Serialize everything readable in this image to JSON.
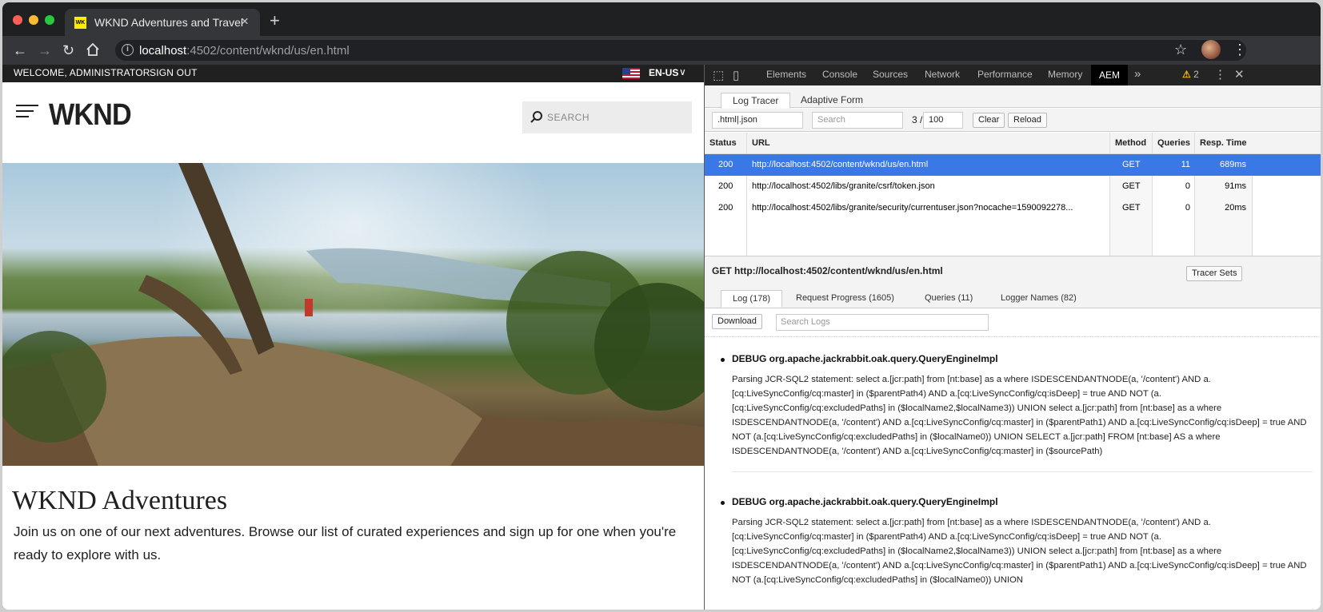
{
  "browser": {
    "tab_title": "WKND Adventures and Travel",
    "tab_favicon": "WK",
    "tab_close": "×",
    "new_tab": "+",
    "url_host": "localhost",
    "url_rest": ":4502/content/wknd/us/en.html",
    "icons": [
      "back-icon",
      "forward-icon",
      "reload-icon",
      "home-icon",
      "info-icon",
      "star-icon",
      "avatar",
      "menu-icon"
    ]
  },
  "site": {
    "welcome": "WELCOME, ADMINISTRATOR",
    "signout": "SIGN OUT",
    "lang": "EN-US",
    "logo": "WKND",
    "search_placeholder": "SEARCH",
    "hero_title": "WKND Adventures",
    "hero_text": "Join us on one of our next adventures. Browse our list of curated experiences and sign up for one when you're ready to explore with us."
  },
  "devtools": {
    "tabs": [
      "Elements",
      "Console",
      "Sources",
      "Network",
      "Performance",
      "Memory",
      "AEM"
    ],
    "more": "»",
    "warnings": "2",
    "panel_tabs": [
      "Log Tracer",
      "Adaptive Form"
    ],
    "filter_value": ".html|.json",
    "search_placeholder": "Search",
    "count_label": "3 /",
    "count_value": "100",
    "clear": "Clear",
    "reload": "Reload",
    "columns": [
      "Status",
      "URL",
      "Method",
      "Queries",
      "Resp. Time"
    ],
    "rows": [
      {
        "status": "200",
        "url": "http://localhost:4502/content/wknd/us/en.html",
        "method": "GET",
        "queries": "11",
        "time": "689ms"
      },
      {
        "status": "200",
        "url": "http://localhost:4502/libs/granite/csrf/token.json",
        "method": "GET",
        "queries": "0",
        "time": "91ms"
      },
      {
        "status": "200",
        "url": "http://localhost:4502/libs/granite/security/currentuser.json?nocache=1590092278...",
        "method": "GET",
        "queries": "0",
        "time": "20ms"
      }
    ],
    "detail_title": "GET http://localhost:4502/content/wknd/us/en.html",
    "tracer_sets": "Tracer Sets",
    "detail_tabs": [
      "Log (178)",
      "Request Progress (1605)",
      "Queries (11)",
      "Logger Names (82)"
    ],
    "download": "Download",
    "search_logs_placeholder": "Search Logs",
    "logs": [
      {
        "head": "DEBUG org.apache.jackrabbit.oak.query.QueryEngineImpl",
        "body": "Parsing JCR-SQL2 statement: select a.[jcr:path] from [nt:base] as a where ISDESCENDANTNODE(a, '/content') AND a.[cq:LiveSyncConfig/cq:master] in ($parentPath4) AND a.[cq:LiveSyncConfig/cq:isDeep] = true AND NOT (a.[cq:LiveSyncConfig/cq:excludedPaths] in ($localName2,$localName3)) UNION select a.[jcr:path] from [nt:base] as a where ISDESCENDANTNODE(a, '/content') AND a.[cq:LiveSyncConfig/cq:master] in ($parentPath1) AND a.[cq:LiveSyncConfig/cq:isDeep] = true AND NOT (a.[cq:LiveSyncConfig/cq:excludedPaths] in ($localName0)) UNION SELECT a.[jcr:path] FROM [nt:base] AS a where ISDESCENDANTNODE(a, '/content') AND a.[cq:LiveSyncConfig/cq:master] in ($sourcePath)"
      },
      {
        "head": "DEBUG org.apache.jackrabbit.oak.query.QueryEngineImpl",
        "body": "Parsing JCR-SQL2 statement: select a.[jcr:path] from [nt:base] as a where ISDESCENDANTNODE(a, '/content') AND a.[cq:LiveSyncConfig/cq:master] in ($parentPath4) AND a.[cq:LiveSyncConfig/cq:isDeep] = true AND NOT (a.[cq:LiveSyncConfig/cq:excludedPaths] in ($localName2,$localName3)) UNION select a.[jcr:path] from [nt:base] as a where ISDESCENDANTNODE(a, '/content') AND a.[cq:LiveSyncConfig/cq:master] in ($parentPath1) AND a.[cq:LiveSyncConfig/cq:isDeep] = true AND NOT (a.[cq:LiveSyncConfig/cq:excludedPaths] in ($localName0)) UNION"
      }
    ],
    "colors": {
      "selected_row": "#3b78e7",
      "active_tab": "#000000",
      "warning": "#f5b400"
    }
  }
}
